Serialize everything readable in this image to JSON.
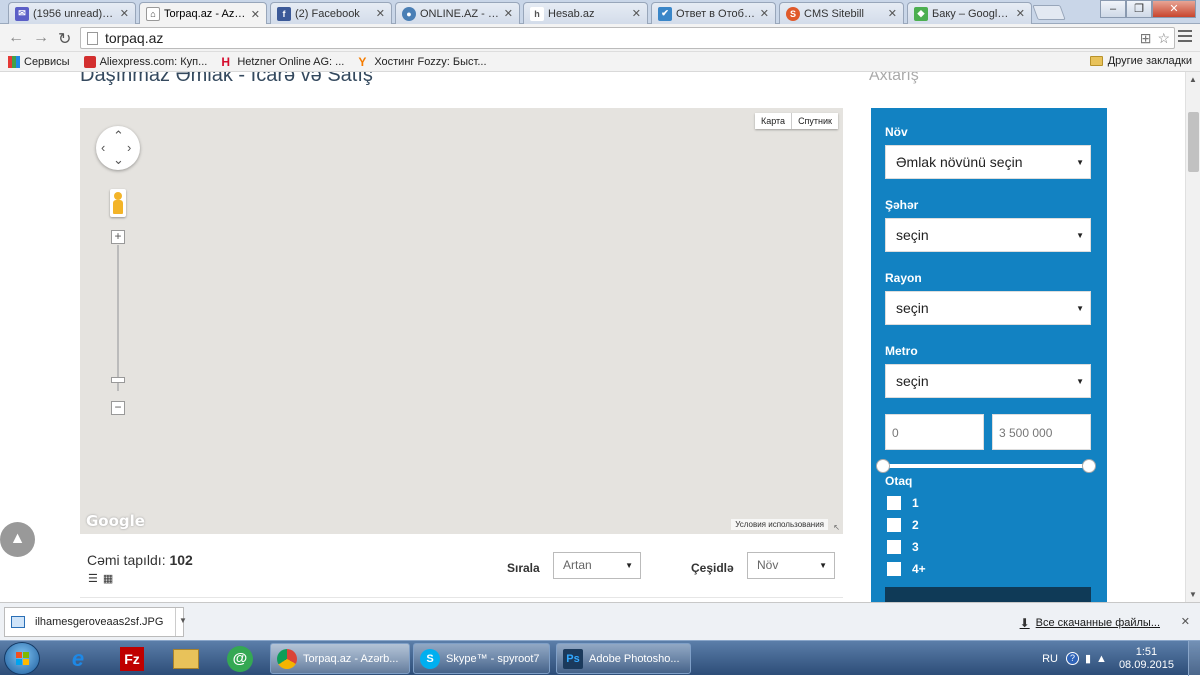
{
  "browser": {
    "tabs": [
      {
        "title": "(1956 unread) - m",
        "icon_color": "#5b5fc7",
        "icon": "mail-icon"
      },
      {
        "title": "Torpaq.az - Azərb",
        "icon_color": "#333333",
        "icon": "house-icon",
        "active": true
      },
      {
        "title": "(2) Facebook",
        "icon_color": "#3b5998",
        "icon": "facebook-icon"
      },
      {
        "title": "ONLINE.AZ - #1 İ",
        "icon_color": "#4a7fb5",
        "icon": "globe-icon"
      },
      {
        "title": "Hesab.az",
        "icon_color": "#555555",
        "icon": "h-icon"
      },
      {
        "title": "Ответ в Отображ",
        "icon_color": "#3a86c8",
        "icon": "check-icon"
      },
      {
        "title": "CMS Sitebill",
        "icon_color": "#e05a2b",
        "icon": "s-icon"
      },
      {
        "title": "Баку – Google Ка",
        "icon_color": "#4caf50",
        "icon": "maps-icon"
      }
    ],
    "url": "torpaq.az",
    "bookmarks": [
      {
        "label": "Сервисы",
        "icon": "apps-icon",
        "color": "#e53935"
      },
      {
        "label": "Aliexpress.com: Куп...",
        "icon": "aliexpress-icon",
        "color": "#d32f2f"
      },
      {
        "label": "Hetzner Online AG: ...",
        "icon": "hetzner-icon",
        "color": "#d50c2d"
      },
      {
        "label": "Хостинг Fozzy: Быст...",
        "icon": "fozzy-icon",
        "color": "#f57c00"
      }
    ],
    "other_bookmarks": "Другие закладки"
  },
  "page": {
    "heading": "Daşınmaz Əmlak - İcarə və Satış",
    "search_heading": "Axtarış",
    "map": {
      "type_map": "Карта",
      "type_satellite": "Спутник",
      "google_logo": "Google",
      "terms": "Условия использования",
      "zoom_in": "+",
      "zoom_out": "−"
    },
    "results": {
      "found_label": "Cəmi tapıldı:",
      "found_count": "102",
      "sort_label": "Sırala",
      "sort_value": "Artan",
      "filter_label": "Çeşidlə",
      "filter_value": "Növ"
    },
    "sidebar": {
      "type_label": "Növ",
      "type_value": "Əmlak növünü seçin",
      "city_label": "Şəhər",
      "city_value": "seçin",
      "district_label": "Rayon",
      "district_value": "seçin",
      "metro_label": "Metro",
      "metro_value": "seçin",
      "price_min": "0",
      "price_max": "3 500 000",
      "rooms_label": "Otaq",
      "rooms": [
        "1",
        "2",
        "3",
        "4+"
      ],
      "accent": "#1282c2"
    }
  },
  "downloads": {
    "file": "ilhamesgeroveaas2sf.JPG",
    "all_link": "Все скачанные файлы..."
  },
  "taskbar": {
    "tasks": [
      {
        "label": "Torpaq.az - Azərb...",
        "icon": "chrome-icon",
        "color": "#3c9a3c"
      },
      {
        "label": "Skype™ - spyroot7",
        "icon": "skype-icon",
        "color": "#00aff0"
      },
      {
        "label": "Adobe Photosho...",
        "icon": "photoshop-icon",
        "color": "#1b3a5c"
      }
    ],
    "lang": "RU",
    "time": "1:51",
    "date": "08.09.2015"
  }
}
